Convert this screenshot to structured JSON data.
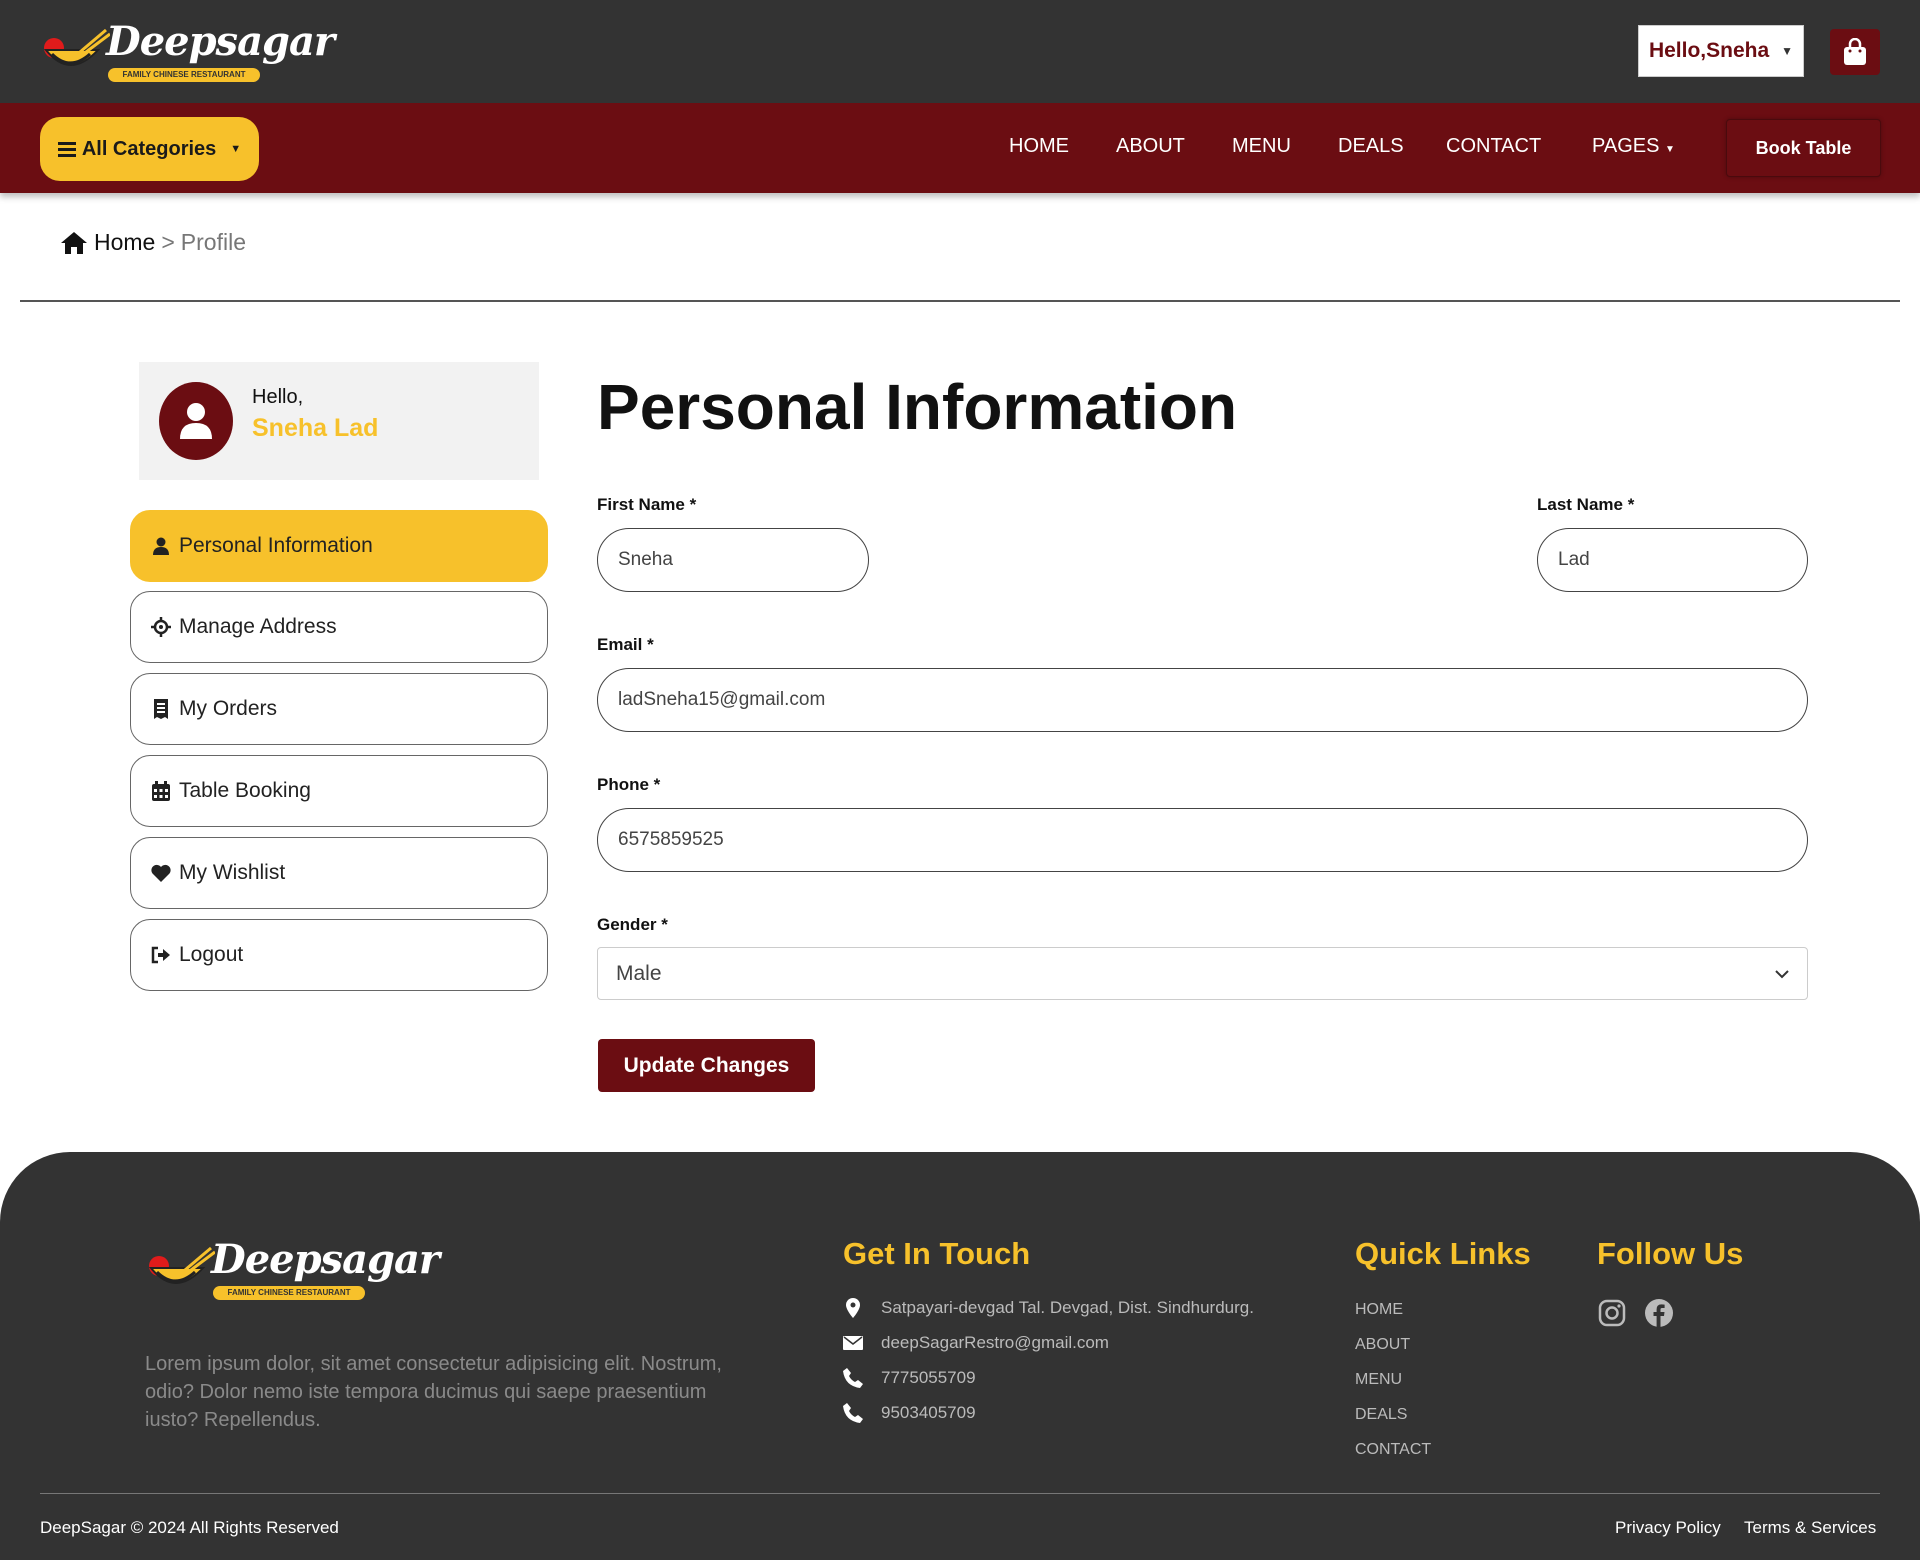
{
  "brand": {
    "name": "Deepsagar",
    "tagline": "FAMILY CHINESE RESTAURANT"
  },
  "header": {
    "greeting_button": "Hello,Sneha"
  },
  "nav": {
    "categories_label": "All Categories",
    "links": [
      "HOME",
      "ABOUT",
      "MENU",
      "DEALS",
      "CONTACT",
      "PAGES"
    ],
    "book_table": "Book Table"
  },
  "breadcrumb": {
    "home": "Home",
    "separator": ">",
    "current": "Profile"
  },
  "sidebar": {
    "hello": "Hello,",
    "user_name": "Sneha Lad",
    "items": [
      {
        "label": "Personal Information",
        "icon": "user-icon",
        "active": true
      },
      {
        "label": "Manage Address",
        "icon": "location-crosshair-icon"
      },
      {
        "label": "My Orders",
        "icon": "receipt-icon"
      },
      {
        "label": "Table Booking",
        "icon": "calendar-icon"
      },
      {
        "label": "My Wishlist",
        "icon": "heart-icon"
      },
      {
        "label": "Logout",
        "icon": "logout-icon"
      }
    ]
  },
  "form": {
    "title": "Personal Information",
    "first_name_label": "First Name *",
    "first_name_value": "Sneha",
    "last_name_label": "Last Name *",
    "last_name_value": "Lad",
    "email_label": "Email *",
    "email_value": "ladSneha15@gmail.com",
    "phone_label": "Phone *",
    "phone_value": "6575859525",
    "gender_label": "Gender *",
    "gender_value": "Male",
    "submit": "Update Changes"
  },
  "footer": {
    "description": "Lorem ipsum dolor, sit amet consectetur adipisicing elit. Nostrum, odio? Dolor nemo iste tempora ducimus qui saepe praesentium iusto? Repellendus.",
    "get_in_touch": "Get In Touch",
    "address": "Satpayari-devgad Tal. Devgad, Dist. Sindhurdurg.",
    "email": "deepSagarRestro@gmail.com",
    "phone1": "7775055709",
    "phone2": "9503405709",
    "quick_links_title": "Quick Links",
    "quick_links": [
      "HOME",
      "ABOUT",
      "MENU",
      "DEALS",
      "CONTACT"
    ],
    "follow_us": "Follow Us",
    "copyright": "DeepSagar © 2024 All Rights Reserved",
    "privacy": "Privacy Policy",
    "terms": "Terms & Services"
  },
  "colors": {
    "dark": "#333333",
    "maroon": "#6b0d12",
    "yellow": "#f7c12b"
  }
}
